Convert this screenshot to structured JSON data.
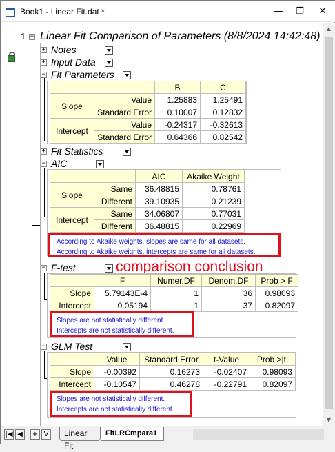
{
  "window": {
    "title": "Book1 - Linear Fit.dat *",
    "minimize": "—",
    "restore": "❐",
    "close": "✕"
  },
  "report": {
    "row_number": "1",
    "title": "Linear Fit Comparison of Parameters (8/8/2024 14:42:48)",
    "collapsed_sections": [
      "Notes",
      "Input Data"
    ],
    "fit_parameters": {
      "label": "Fit Parameters",
      "columns": [
        "B",
        "C"
      ],
      "rows": [
        {
          "group": "Slope",
          "label": "Value",
          "values": [
            "1.25883",
            "1.25491"
          ]
        },
        {
          "group": "Slope",
          "label": "Standard Error",
          "values": [
            "0.10007",
            "0.12832"
          ]
        },
        {
          "group": "Intercept",
          "label": "Value",
          "values": [
            "-0.24317",
            "-0.32613"
          ]
        },
        {
          "group": "Intercept",
          "label": "Standard Error",
          "values": [
            "0.64366",
            "0.82542"
          ]
        }
      ]
    },
    "fit_statistics": {
      "label": "Fit Statistics"
    },
    "aic": {
      "label": "AIC",
      "columns": [
        "AIC",
        "Akaike Weight"
      ],
      "rows": [
        {
          "group": "Slope",
          "label": "Same",
          "values": [
            "36.48815",
            "0.78761"
          ]
        },
        {
          "group": "Slope",
          "label": "Different",
          "values": [
            "39.10935",
            "0.21239"
          ]
        },
        {
          "group": "Intercept",
          "label": "Same",
          "values": [
            "34.06807",
            "0.77031"
          ]
        },
        {
          "group": "Intercept",
          "label": "Different",
          "values": [
            "36.48815",
            "0.22969"
          ]
        }
      ],
      "notes": [
        "According to Akaike weights, slopes are same for all datasets.",
        "According to Akaike weights, intercepts are same for all datasets."
      ]
    },
    "ftest": {
      "label": "F-test",
      "columns": [
        "F",
        "Numer.DF",
        "Denom.DF",
        "Prob > F"
      ],
      "rows": [
        {
          "label": "Slope",
          "values": [
            "5.79143E-4",
            "1",
            "36",
            "0.98093"
          ]
        },
        {
          "label": "Intercept",
          "values": [
            "0.05194",
            "1",
            "37",
            "0.82097"
          ]
        }
      ],
      "notes": [
        "Slopes are not statistically different.",
        "Intercepts are not statistically different."
      ]
    },
    "glm": {
      "label": "GLM Test",
      "columns": [
        "Value",
        "Standard Error",
        "t-Value",
        "Prob >|t|"
      ],
      "rows": [
        {
          "label": "Slope",
          "values": [
            "-0.00392",
            "0.16273",
            "-0.02407",
            "0.98093"
          ]
        },
        {
          "label": "Intercept",
          "values": [
            "-0.10547",
            "0.46278",
            "-0.22791",
            "0.82097"
          ]
        }
      ],
      "notes": [
        "Slopes are not statistically different.",
        "Intercepts are not statistically different."
      ]
    }
  },
  "annotation": {
    "text": "comparison conclusion",
    "color": "#e0101c"
  },
  "tabs": [
    {
      "label": "Linear Fit"
    },
    {
      "label": "FitLRCmpara1"
    }
  ],
  "nav_buttons": [
    "|◀",
    "◀",
    "+",
    "V"
  ]
}
